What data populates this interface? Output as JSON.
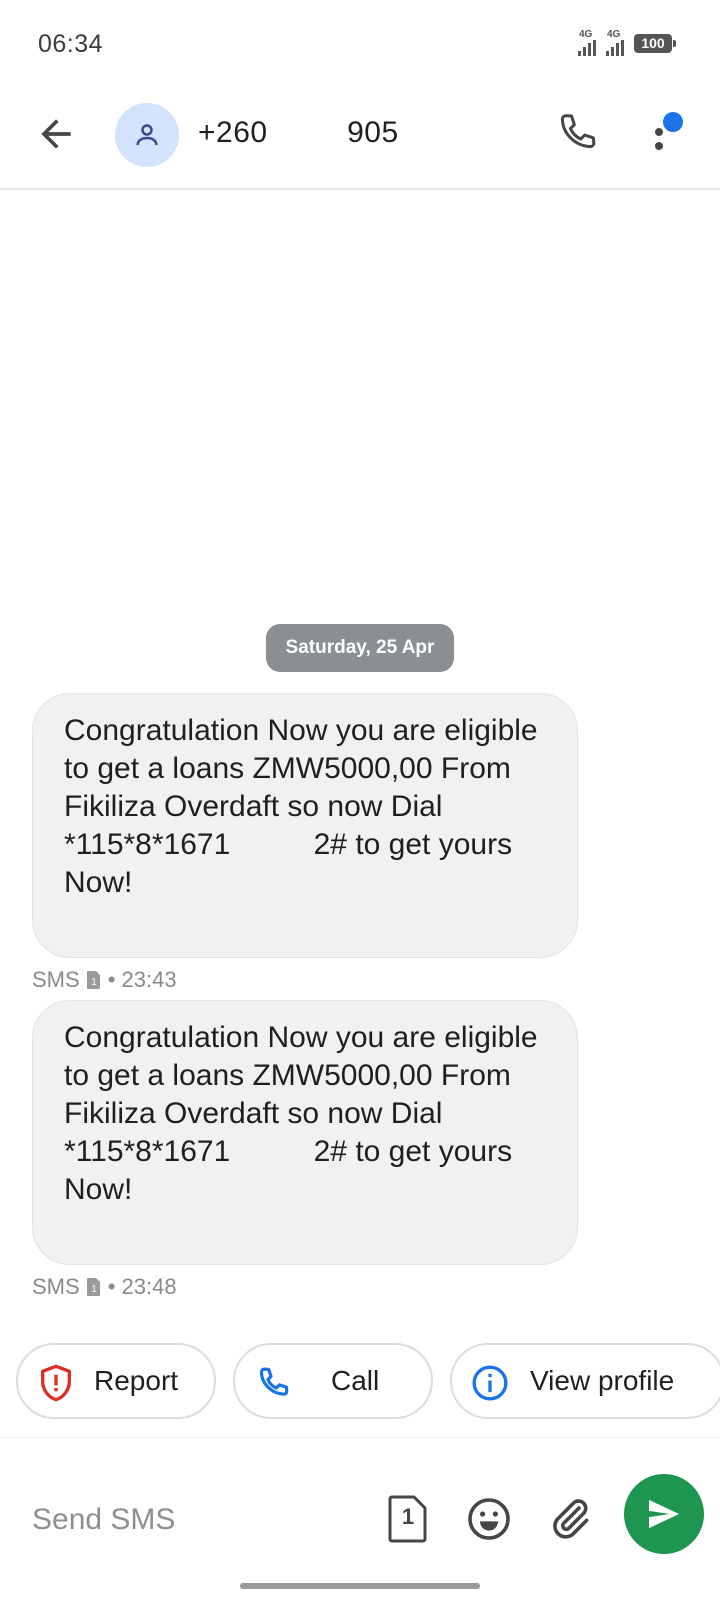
{
  "status_bar": {
    "time": "06:34",
    "network_1": "4G",
    "network_2": "4G",
    "battery": "100"
  },
  "header": {
    "contact": "+260         905",
    "icons": [
      "back-arrow-icon",
      "person-icon",
      "phone-icon",
      "more-vert-icon"
    ],
    "notification_dot_color": "#1a73e8"
  },
  "conversation": {
    "date_chip": "Saturday, 25 Apr",
    "messages": [
      {
        "text": "Congratulation Now you are eligible to get a loans ZMW5000,00 From Fikiliza Overdaft so now Dial *115*8*1671          2# to get yours Now!",
        "type": "SMS",
        "time": "• 23:43"
      },
      {
        "text": "Congratulation Now you are eligible to get a loans ZMW5000,00 From Fikiliza Overdaft so now Dial *115*8*1671          2# to get yours Now!",
        "type": "SMS",
        "time": "• 23:48"
      }
    ]
  },
  "suggestions": {
    "report": "Report",
    "call": "Call",
    "view_profile": "View profile"
  },
  "compose": {
    "placeholder": "Send SMS",
    "sim_number": "1",
    "send_color": "#1e9650"
  },
  "colors": {
    "bubble": "#f0f1f1",
    "avatar_bg": "#d3e3fd",
    "report_red": "#d93025",
    "call_blue": "#1a73e8"
  }
}
